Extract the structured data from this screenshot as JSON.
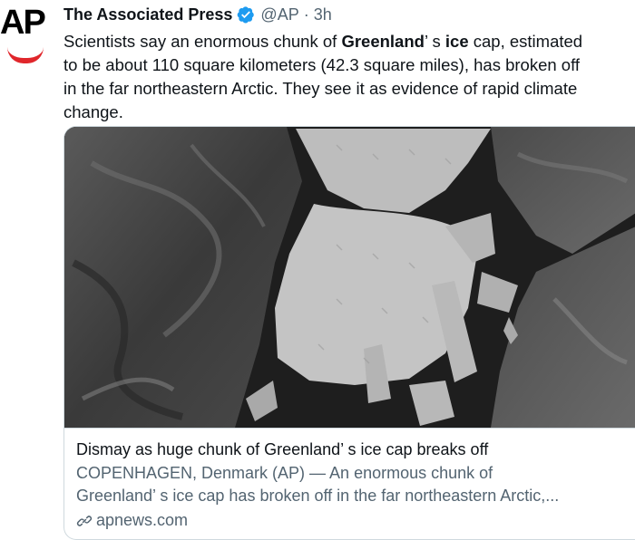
{
  "tweet": {
    "author_logo": "AP",
    "author_name": "The Associated Press",
    "handle": "@AP",
    "separator": "·",
    "time": "3h",
    "text_parts": [
      {
        "text": "Scientists say an enormous chunk of ",
        "bold": false
      },
      {
        "text": "Greenland",
        "bold": true
      },
      {
        "text": "’ s ",
        "bold": false
      },
      {
        "text": "ice",
        "bold": true
      },
      {
        "text": " cap, estimated\nto be about 110 square kilometers (42.3 square miles), has broken off\nin the far northeastern Arctic. They see it as evidence of rapid climate\nchange.",
        "bold": false
      }
    ],
    "colors": {
      "text": "#0f1419",
      "secondary": "#536471",
      "verified": "#1d9bf0",
      "brand_red": "#e0262b"
    }
  },
  "card": {
    "image_icon": "satellite-ice-image",
    "title": "Dismay as huge chunk of Greenland’ s ice cap breaks off",
    "description": "COPENHAGEN, Denmark (AP) — An enormous chunk of\nGreenland’ s ice cap has broken off in the far northeastern Arctic,...",
    "domain": "apnews.com",
    "link_icon": "link-icon"
  }
}
